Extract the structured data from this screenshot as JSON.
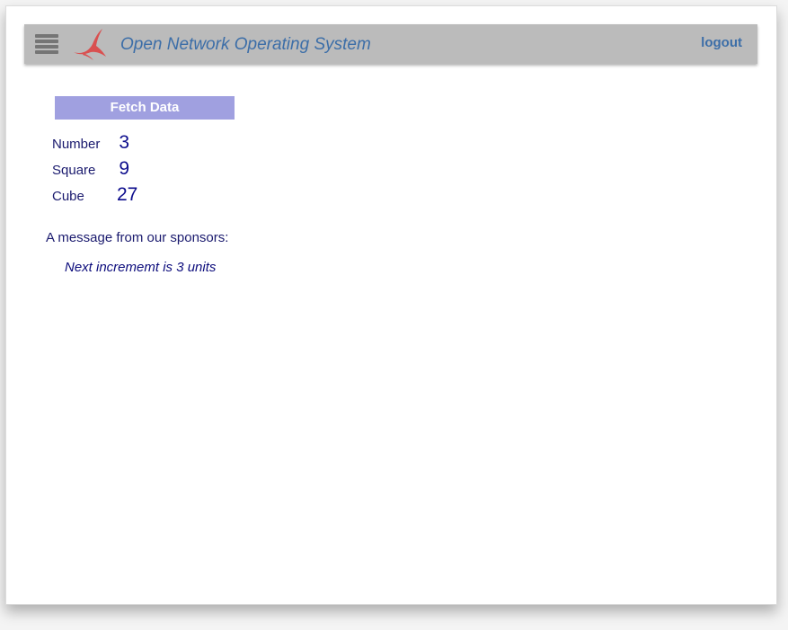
{
  "header": {
    "title": "Open Network Operating System",
    "logout_label": "logout",
    "menu_icon": "hamburger-menu-icon",
    "logo_icon": "onos-bird-logo",
    "background_color": "#bbbbbb",
    "title_color": "#3c6ea8"
  },
  "main": {
    "fetch_button_label": "Fetch Data",
    "fetch_button_color": "#a0a0e0",
    "rows": [
      {
        "label": "Number",
        "value": "3"
      },
      {
        "label": "Square",
        "value": "9"
      },
      {
        "label": "Cube",
        "value": "27"
      }
    ],
    "sponsor_heading": "A message from our sponsors:",
    "sponsor_message": "Next incrememt is 3 units"
  }
}
